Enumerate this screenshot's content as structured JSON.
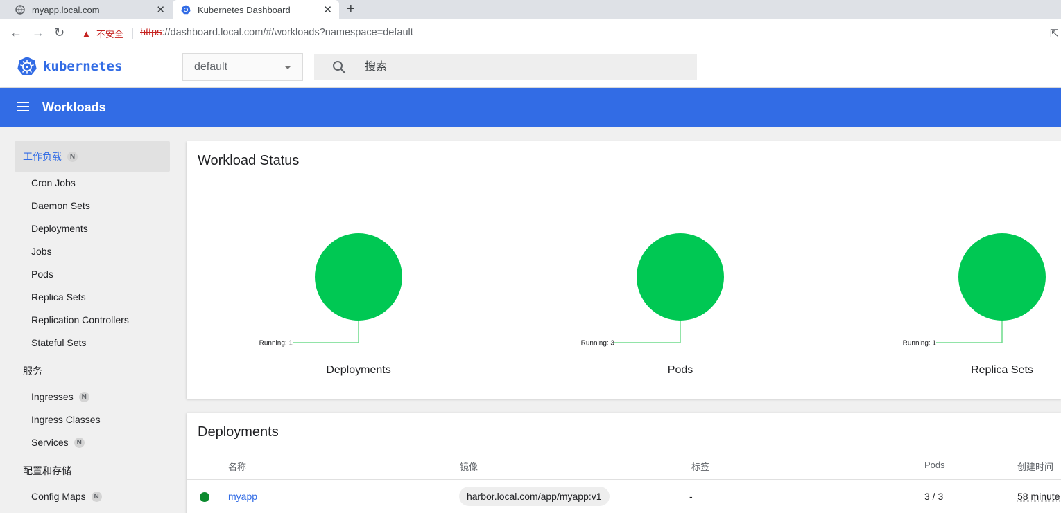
{
  "browser": {
    "tabs": [
      {
        "title": "myapp.local.com",
        "active": false
      },
      {
        "title": "Kubernetes Dashboard",
        "active": true
      }
    ],
    "security_label": "不安全",
    "url_scheme": "https",
    "url_rest": "://dashboard.local.com/#/workloads?namespace=default"
  },
  "header": {
    "logo_text": "kubernetes",
    "namespace": "default",
    "search_placeholder": "搜索"
  },
  "toolbar": {
    "title": "Workloads"
  },
  "sidebar": {
    "workloads_section": "工作负载",
    "badge": "N",
    "workload_items": [
      "Cron Jobs",
      "Daemon Sets",
      "Deployments",
      "Jobs",
      "Pods",
      "Replica Sets",
      "Replication Controllers",
      "Stateful Sets"
    ],
    "services_section": "服务",
    "service_items": [
      "Ingresses",
      "Ingress Classes",
      "Services"
    ],
    "config_section": "配置和存储",
    "config_items": [
      "Config Maps"
    ]
  },
  "workload_status": {
    "title": "Workload Status",
    "charts": [
      {
        "name": "Deployments",
        "label": "Running: 1",
        "running": 1
      },
      {
        "name": "Pods",
        "label": "Running: 3",
        "running": 3
      },
      {
        "name": "Replica Sets",
        "label": "Running: 1",
        "running": 1
      }
    ],
    "running_color": "#00c853"
  },
  "deployments": {
    "title": "Deployments",
    "columns": [
      "名称",
      "镜像",
      "标签",
      "Pods",
      "创建时间"
    ],
    "rows": [
      {
        "name": "myapp",
        "image": "harbor.local.com/app/myapp:v1",
        "labels": "-",
        "pods": "3 / 3",
        "created": "58 minute"
      }
    ]
  },
  "colors": {
    "brand": "#326ce5",
    "status_ok": "#0b8a2e"
  }
}
